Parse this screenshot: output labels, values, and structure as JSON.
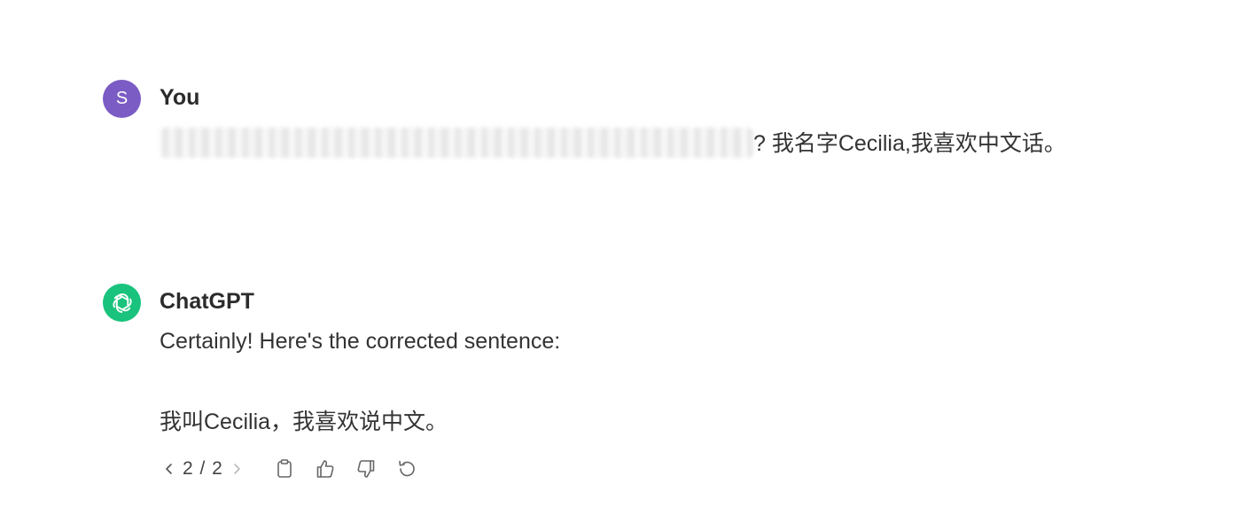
{
  "conversation": {
    "user_message": {
      "avatar_letter": "S",
      "avatar_color": "#7b5bc4",
      "author": "You",
      "visible_text": "? 我名字Cecilia,我喜欢中文话。"
    },
    "assistant_message": {
      "avatar_color": "#19c37d",
      "avatar_icon": "openai-logo-icon",
      "author": "ChatGPT",
      "line1": "Certainly! Here's the corrected sentence:",
      "line2": "我叫Cecilia，我喜欢说中文。",
      "pager": {
        "current": 2,
        "total": 2,
        "label": "2 / 2"
      },
      "actions": [
        "copy-icon",
        "thumbs-up-icon",
        "thumbs-down-icon",
        "regenerate-icon"
      ]
    }
  }
}
